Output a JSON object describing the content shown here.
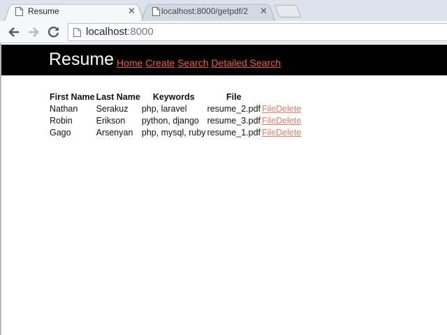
{
  "browser": {
    "tabs": [
      {
        "title": "Resume",
        "active": true
      },
      {
        "title": "localhost:8000/getpdf/2",
        "active": false
      }
    ],
    "url_host": "localhost",
    "url_port": ":8000"
  },
  "header": {
    "brand": "Resume",
    "links": [
      "Home",
      "Create",
      "Search",
      "Detailed Search"
    ]
  },
  "table": {
    "columns": [
      "First Name",
      "Last Name",
      "Keywords",
      "File"
    ],
    "rows": [
      {
        "first": "Nathan",
        "last": "Serakuz",
        "keywords": "php, laravel",
        "file": "resume_2.pdf",
        "file_link": "File",
        "delete_link": "Delete"
      },
      {
        "first": "Robin",
        "last": "Erikson",
        "keywords": "python, django",
        "file": "resume_3.pdf",
        "file_link": "File",
        "delete_link": "Delete"
      },
      {
        "first": "Gago",
        "last": "Arsenyan",
        "keywords": "php, mysql, ruby",
        "file": "resume_1.pdf",
        "file_link": "File",
        "delete_link": "Delete"
      }
    ]
  },
  "colors": {
    "header_bg": "#000000",
    "nav_link": "#e8604c",
    "table_link": "#d9806a"
  }
}
